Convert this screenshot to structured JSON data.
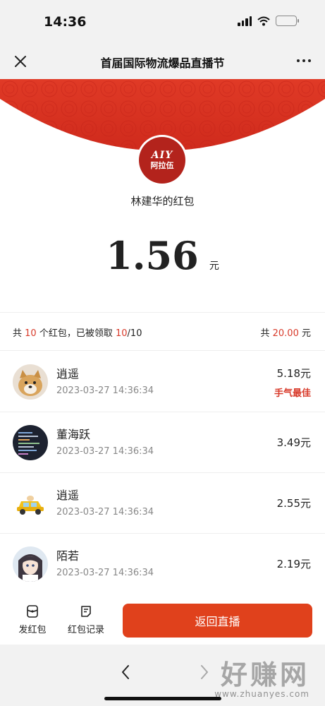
{
  "status": {
    "time": "14:36"
  },
  "nav": {
    "title": "首届国际物流爆品直播节",
    "close_icon": "close-icon",
    "more_icon": "more-icon"
  },
  "packet": {
    "avatar_logo_line1": "AIY",
    "avatar_logo_line2": "阿拉伍",
    "sender": "林建华的红包",
    "amount": "1.56",
    "unit": "元"
  },
  "summary": {
    "prefix": "共",
    "count": "10",
    "mid": "个红包，已被领取",
    "claimed": "10",
    "total_sep": "/10",
    "total_prefix": "共",
    "total_amount": "20.00",
    "total_unit": "元"
  },
  "records": [
    {
      "name": "逍遥",
      "time": "2023-03-27 14:36:34",
      "amount": "5.18元",
      "badge": "手气最佳"
    },
    {
      "name": "董海跃",
      "time": "2023-03-27 14:36:34",
      "amount": "3.49元",
      "badge": ""
    },
    {
      "name": "逍遥",
      "time": "2023-03-27 14:36:34",
      "amount": "2.55元",
      "badge": ""
    },
    {
      "name": "陌若",
      "time": "2023-03-27 14:36:34",
      "amount": "2.19元",
      "badge": ""
    }
  ],
  "bottom": {
    "send_packet": "发红包",
    "packet_records": "红包记录",
    "back_live": "返回直播"
  },
  "watermark": {
    "main": "好赚网",
    "sub": "www.zhuanyes.com"
  },
  "colors": {
    "accent": "#e0411c",
    "red_text": "#d83a2a",
    "header_red": "#d62f20"
  }
}
